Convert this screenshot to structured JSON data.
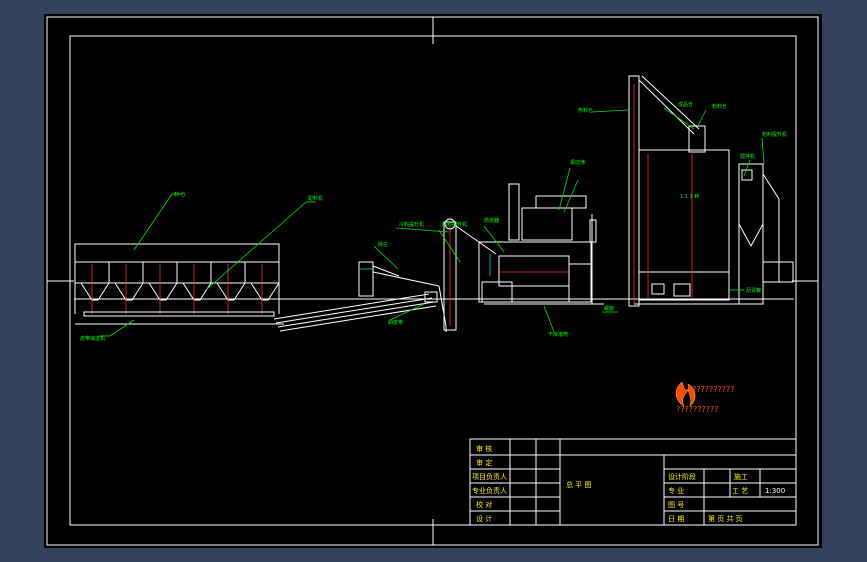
{
  "labels": {
    "l1": "料 仓",
    "l2": "配料机",
    "l3": "皮带输送机",
    "l4": "斜皮带",
    "l5": "除尘",
    "l6": "冷料提升机",
    "l7": "热料提升机",
    "l8": "振动筛",
    "l9": "干燥滚筒",
    "l10": "燃烧器",
    "l11": "热料仓",
    "l12": "成品仓",
    "l13": "粉料仓",
    "l14": "搅拌机",
    "l15": "粉料提升机",
    "l16": "螺旋",
    "l17": "沥青罐",
    "tower_label": "1 1 1 秤"
  },
  "logo": {
    "line1": "??????????",
    "line2": "??????????"
  },
  "title_block": {
    "r1": "审 核",
    "r2": "审 定",
    "r3": "项目负责人",
    "r4": "专业负责人",
    "r5": "校 对",
    "r6": "设 计",
    "drawing_name": "总 平 图",
    "c1": "设计阶段",
    "c2": "专 业",
    "c3": "图 号",
    "c4": "日 期",
    "v1": "施工",
    "v2": "工 艺",
    "scale": "1:300",
    "v4": "第 页 共 页"
  },
  "colors": {
    "line": "#ffffff",
    "annotation": "#00ff00",
    "hidden": "#ff2a2a",
    "accent": "#00cfcf",
    "title_yellow": "#ffee00"
  }
}
